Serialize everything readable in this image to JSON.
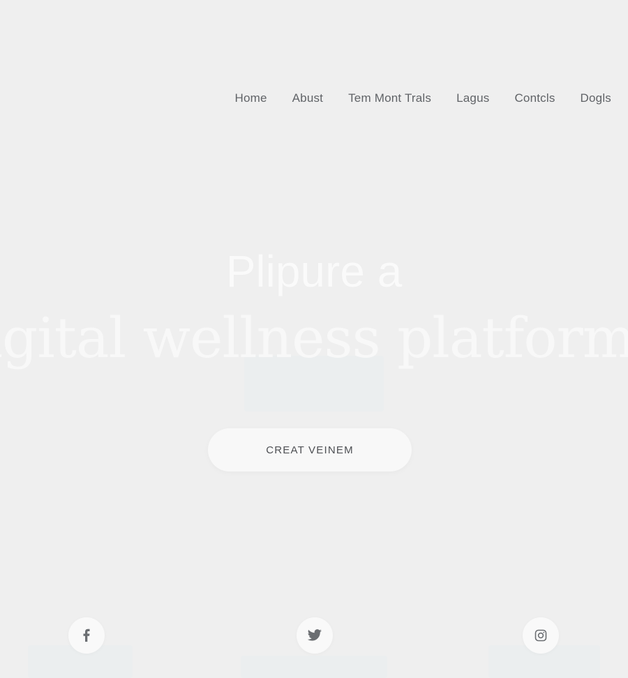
{
  "nav": {
    "items": [
      {
        "label": "Home"
      },
      {
        "label": "Abust"
      },
      {
        "label": "Tem Mont Trals"
      },
      {
        "label": "Lagus"
      },
      {
        "label": "Contcls"
      },
      {
        "label": "Dogls"
      }
    ]
  },
  "hero": {
    "line1": "Plipure a",
    "line2": "igital wellness platform"
  },
  "cta": {
    "label": "CREAT VEINEM"
  },
  "social": {
    "facebook": {
      "icon": "facebook-icon"
    },
    "twitter": {
      "icon": "twitter-icon"
    },
    "instagram": {
      "icon": "instagram-icon"
    }
  },
  "colors": {
    "background": "#efefef",
    "nav_text": "#606367",
    "hero_text": "#f8f8f8",
    "button_bg": "#f8f8f8",
    "icon": "#6b6e72"
  }
}
